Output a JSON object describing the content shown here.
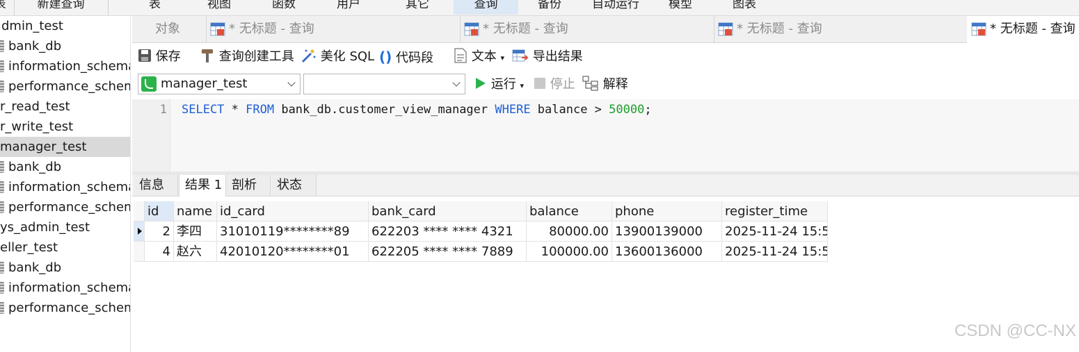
{
  "menu": {
    "items": [
      "表",
      "新建查询",
      "表",
      "视图",
      "函数",
      "用户",
      "其它",
      "查询",
      "备份",
      "自动运行",
      "模型",
      "图表"
    ],
    "active_index": 7
  },
  "tree": {
    "nodes": [
      {
        "label": "dmin_test",
        "level": 0
      },
      {
        "label": "bank_db",
        "level": 1
      },
      {
        "label": "information_schema",
        "level": 1
      },
      {
        "label": "performance_schema",
        "level": 1
      },
      {
        "label": "r_read_test",
        "level": 0
      },
      {
        "label": "r_write_test",
        "level": 0
      },
      {
        "label": "manager_test",
        "level": 0,
        "selected": true
      },
      {
        "label": "bank_db",
        "level": 1
      },
      {
        "label": "information_schema",
        "level": 1
      },
      {
        "label": "performance_schema",
        "level": 1
      },
      {
        "label": "ys_admin_test",
        "level": 0
      },
      {
        "label": "eller_test",
        "level": 0
      },
      {
        "label": "bank_db",
        "level": 1
      },
      {
        "label": "information_schema",
        "level": 1
      },
      {
        "label": "performance_schema",
        "level": 1
      }
    ]
  },
  "tabs": {
    "objects": "对象",
    "query_tabs": [
      "* 无标题 - 查询",
      "* 无标题 - 查询",
      "* 无标题 - 查询",
      "* 无标题 - 查询"
    ]
  },
  "toolbar": {
    "save": "保存",
    "query_builder": "查询创建工具",
    "beautify": "美化 SQL",
    "snippet": "代码段",
    "text": "文本",
    "export": "导出结果",
    "connection": "manager_test",
    "database": "",
    "run": "运行",
    "stop": "停止",
    "explain": "解释"
  },
  "editor": {
    "line_number": "1",
    "kw_select": "SELECT",
    "star": " * ",
    "kw_from": "FROM",
    "table": " bank_db.customer_view_manager ",
    "kw_where": "WHERE",
    "cond": " balance > ",
    "value": "50000",
    "end": ";"
  },
  "result_tabs": [
    "信息",
    "结果 1",
    "剖析",
    "状态"
  ],
  "grid": {
    "columns": [
      "id",
      "name",
      "id_card",
      "bank_card",
      "balance",
      "phone",
      "register_time"
    ],
    "rows": [
      [
        "2",
        "李四",
        "31010119********89",
        "622203 **** **** 4321",
        "80000.00",
        "13900139000",
        "2025-11-24 15:5"
      ],
      [
        "4",
        "赵六",
        "42010120********01",
        "622205 **** **** 7889",
        "100000.00",
        "13600136000",
        "2025-11-24 15:5"
      ]
    ]
  },
  "watermark": "CSDN @CC-NX",
  "colors": {
    "keyword": "#1f5fd6",
    "number": "#1e9f2c",
    "run_green": "#2db24a",
    "active_tab_bg": "#dce8f5"
  }
}
